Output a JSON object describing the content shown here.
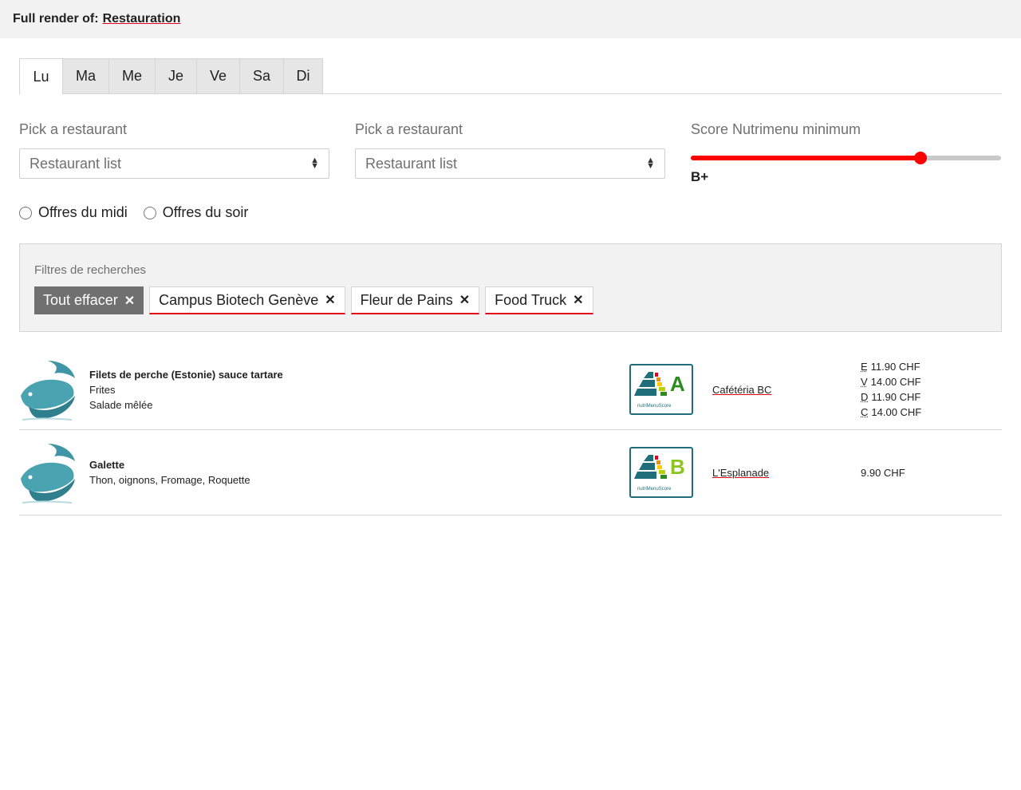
{
  "header": {
    "prefix": "Full render of:",
    "link": "Restauration"
  },
  "tabs": [
    {
      "label": "Lu",
      "active": true
    },
    {
      "label": "Ma",
      "active": false
    },
    {
      "label": "Me",
      "active": false
    },
    {
      "label": "Je",
      "active": false
    },
    {
      "label": "Ve",
      "active": false
    },
    {
      "label": "Sa",
      "active": false
    },
    {
      "label": "Di",
      "active": false
    }
  ],
  "filters": {
    "select1": {
      "label": "Pick a restaurant",
      "value": "Restaurant list"
    },
    "select2": {
      "label": "Pick a restaurant",
      "value": "Restaurant list"
    },
    "score": {
      "label": "Score Nutrimenu minimum",
      "value": "B+",
      "fraction": 0.74
    }
  },
  "radios": {
    "lunch": "Offres du midi",
    "evening": "Offres du soir"
  },
  "search": {
    "title": "Filtres de recherches",
    "clear": "Tout effacer",
    "chips": [
      "Campus Biotech Genève",
      "Fleur de Pains",
      "Food Truck"
    ]
  },
  "menus": [
    {
      "name": "Filets de perche (Estonie) sauce tartare",
      "lines": [
        "Frites",
        "Salade mêlée"
      ],
      "grade": "A",
      "restaurant": "Cafétéria BC",
      "prices": [
        {
          "code": "E",
          "price": "11.90 CHF"
        },
        {
          "code": "V",
          "price": "14.00 CHF"
        },
        {
          "code": "D",
          "price": "11.90 CHF"
        },
        {
          "code": "C",
          "price": "14.00 CHF"
        }
      ]
    },
    {
      "name": "Galette",
      "lines": [
        "Thon, oignons, Fromage, Roquette"
      ],
      "grade": "B",
      "restaurant": "L'Esplanade",
      "prices": [
        {
          "code": "",
          "price": "9.90 CHF"
        }
      ]
    }
  ],
  "colors": {
    "accent": "#e2001a",
    "slider": "#ff0000",
    "teal": "#1f6e7a",
    "gradeA": "#2e8b22",
    "gradeB": "#8cc51f"
  }
}
